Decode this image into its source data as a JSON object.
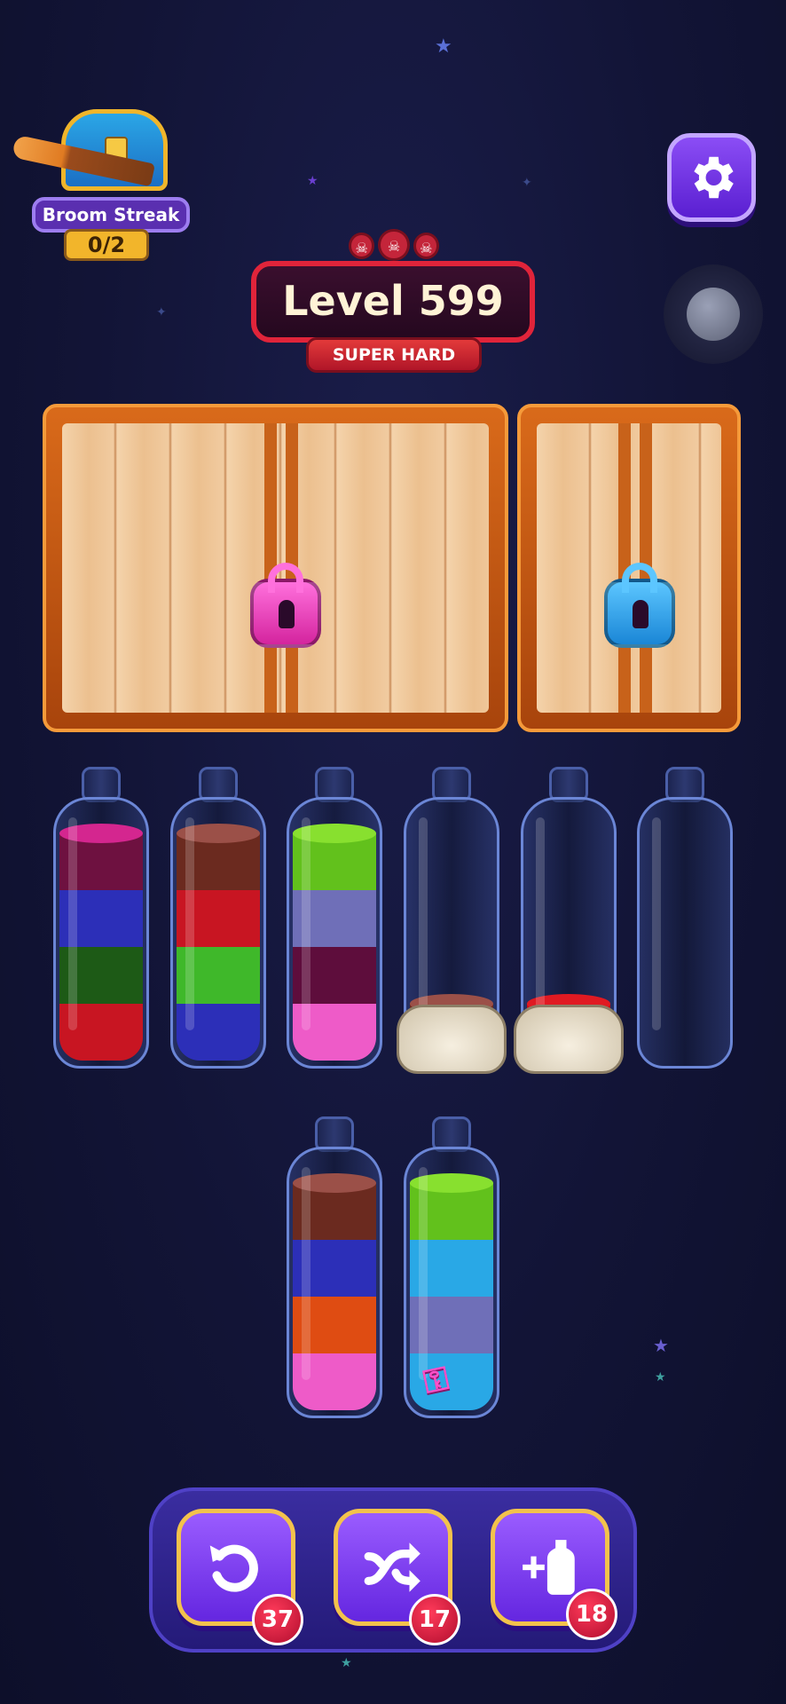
{
  "streak": {
    "label": "Broom Streak",
    "count": "0/2"
  },
  "level": {
    "title": "Level 599",
    "difficulty": "SUPER HARD"
  },
  "locks": [
    {
      "color": "#ff4fd0",
      "name": "pink-padlock"
    },
    {
      "color": "#29a8f0",
      "name": "blue-padlock"
    }
  ],
  "bottles_row1": [
    {
      "layers_bottom_to_top": [
        "#c81522",
        "#1d5a16",
        "#2c2fb8",
        "#6e1140"
      ],
      "top_color": "#d4268f",
      "covered": false
    },
    {
      "layers_bottom_to_top": [
        "#2c2fb8",
        "#3fb82a",
        "#c81522",
        "#6b2a1f"
      ],
      "top_color": "#9b5048",
      "covered": false
    },
    {
      "layers_bottom_to_top": [
        "#ee5bc8",
        "#5e0d3c",
        "#6f6fb8",
        "#62c11c"
      ],
      "top_color": "#88e02f",
      "covered": false
    },
    {
      "layers_bottom_to_top": [
        "#6b2a1f"
      ],
      "top_color": "#9b5048",
      "covered": true
    },
    {
      "layers_bottom_to_top": [
        "#c80a12"
      ],
      "top_color": "#e01a22",
      "covered": true
    },
    {
      "layers_bottom_to_top": [],
      "top_color": "",
      "covered": false
    }
  ],
  "bottles_row2": [
    {
      "layers_bottom_to_top": [
        "#ee5bc8",
        "#df4c12",
        "#2c2fb8",
        "#6b2a1f"
      ],
      "top_color": "#9b5048",
      "key": false
    },
    {
      "layers_bottom_to_top": [
        "#29a8e6",
        "#6f6fb8",
        "#29a8e6",
        "#62c11c"
      ],
      "top_color": "#88e02f",
      "key": true
    }
  ],
  "tools": [
    {
      "name": "undo",
      "count": "37"
    },
    {
      "name": "shuffle",
      "count": "17"
    },
    {
      "name": "add-bottle",
      "count": "18"
    }
  ]
}
